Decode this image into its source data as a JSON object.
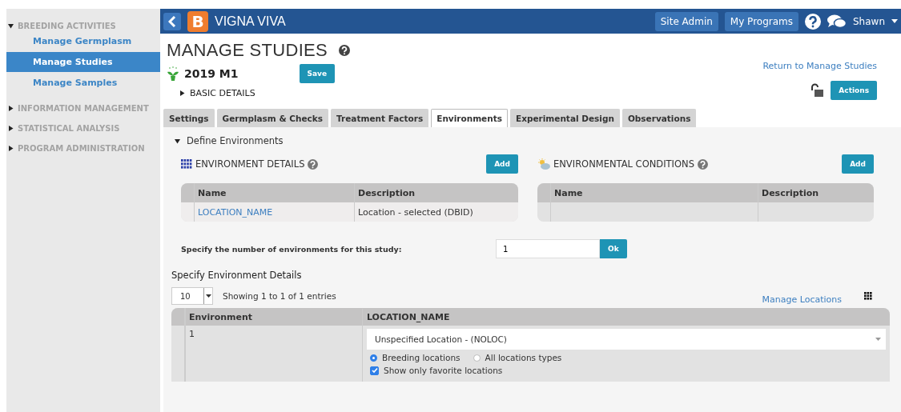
{
  "sidebar": {
    "sections": [
      {
        "label": "BREEDING ACTIVITIES",
        "expanded": true,
        "items": [
          {
            "label": "Manage Germplasm",
            "selected": false
          },
          {
            "label": "Manage Studies",
            "selected": true
          },
          {
            "label": "Manage Samples",
            "selected": false
          }
        ]
      },
      {
        "label": "INFORMATION MANAGEMENT",
        "expanded": false
      },
      {
        "label": "STATISTICAL ANALYSIS",
        "expanded": false
      },
      {
        "label": "PROGRAM ADMINISTRATION",
        "expanded": false
      }
    ]
  },
  "header": {
    "logo_letter": "B",
    "app_name": "VIGNA VIVA",
    "buttons": [
      "Site Admin",
      "My Programs"
    ],
    "user": "Shawn"
  },
  "page": {
    "title": "MANAGE STUDIES",
    "study_name": "2019 M1",
    "save_button": "Save",
    "basic_details": {
      "label": "BASIC DETAILS",
      "expanded": false
    },
    "return_link": "Return to Manage Studies",
    "actions_button": "Actions"
  },
  "tabs": [
    {
      "label": "Settings",
      "selected": false
    },
    {
      "label": "Germplasm & Checks",
      "selected": false
    },
    {
      "label": "Treatment Factors",
      "selected": false
    },
    {
      "label": "Environments",
      "selected": true
    },
    {
      "label": "Experimental Design",
      "selected": false
    },
    {
      "label": "Observations",
      "selected": false
    }
  ],
  "define_environments": {
    "label": "Define Environments",
    "expanded": true
  },
  "environment_details": {
    "title": "ENVIRONMENT DETAILS",
    "add_button": "Add",
    "columns": [
      "Name",
      "Description"
    ],
    "rows": [
      {
        "name": "LOCATION_NAME",
        "description": "Location - selected (DBID)"
      }
    ]
  },
  "environmental_conditions": {
    "title": "ENVIRONMENTAL CONDITIONS",
    "add_button": "Add",
    "columns": [
      "Name",
      "Description"
    ]
  },
  "number_prompt": {
    "label": "Specify the number of environments for this study:",
    "value": "1",
    "ok_button": "Ok"
  },
  "details_table": {
    "title": "Specify Environment Details",
    "page_size": "10",
    "entries": "Showing 1 to 1 of 1 entries",
    "manage_link": "Manage Locations",
    "columns": [
      "Environment",
      "LOCATION_NAME"
    ],
    "rows": [
      {
        "environment": "1",
        "location": "Unspecified Location - (NOLOC)",
        "filters": [
          {
            "label": "Breeding locations",
            "selected": true
          },
          {
            "label": "All locations types",
            "selected": false
          }
        ],
        "favorites": {
          "label": "Show only favorite locations",
          "checked": true
        }
      }
    ]
  }
}
